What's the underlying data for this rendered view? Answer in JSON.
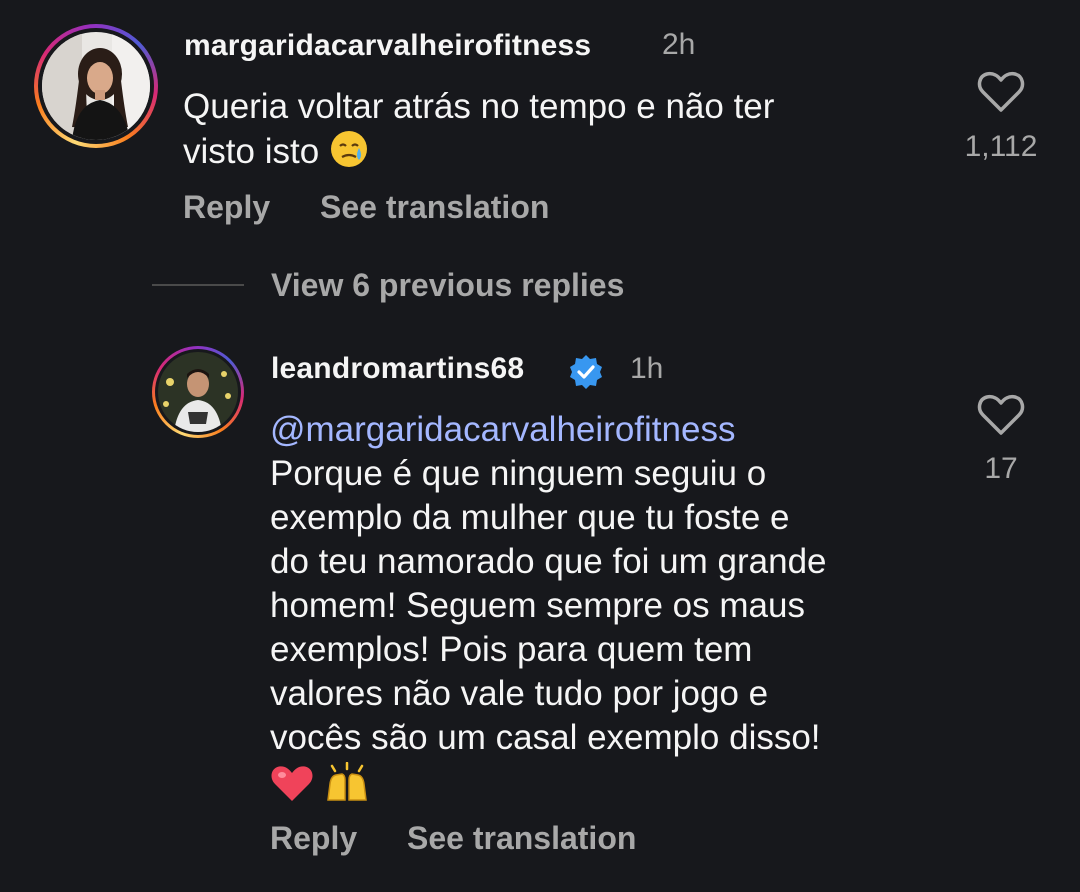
{
  "comment1": {
    "username": "margaridacarvalheirofitness",
    "time": "2h",
    "text_lines": [
      "Queria voltar atrás no tempo e não ter",
      "visto isto"
    ],
    "emoji": "face-holding-back-tears",
    "likes": "1,112",
    "reply_label": "Reply",
    "translation_label": "See translation"
  },
  "view_replies": {
    "label": "View 6 previous replies"
  },
  "comment2": {
    "username": "leandromartins68",
    "verified": true,
    "time": "1h",
    "mention": "@margaridacarvalheirofitness",
    "text_lines": [
      "Porque é que ninguem seguiu o",
      "exemplo da mulher que tu foste e",
      "do teu namorado que foi um grande",
      "homem! Seguem sempre os maus",
      "exemplos! Pois para quem tem",
      "valores não vale tudo por jogo e",
      "vocês são um casal exemplo disso!"
    ],
    "emojis": [
      "red-heart",
      "raising-hands"
    ],
    "likes": "17",
    "reply_label": "Reply",
    "translation_label": "See translation"
  },
  "colors": {
    "background": "#17181c",
    "text_primary": "#f5f5f5",
    "text_secondary": "#a8a8a8",
    "mention": "#a4b7ff",
    "verified_badge": "#3897f0"
  }
}
